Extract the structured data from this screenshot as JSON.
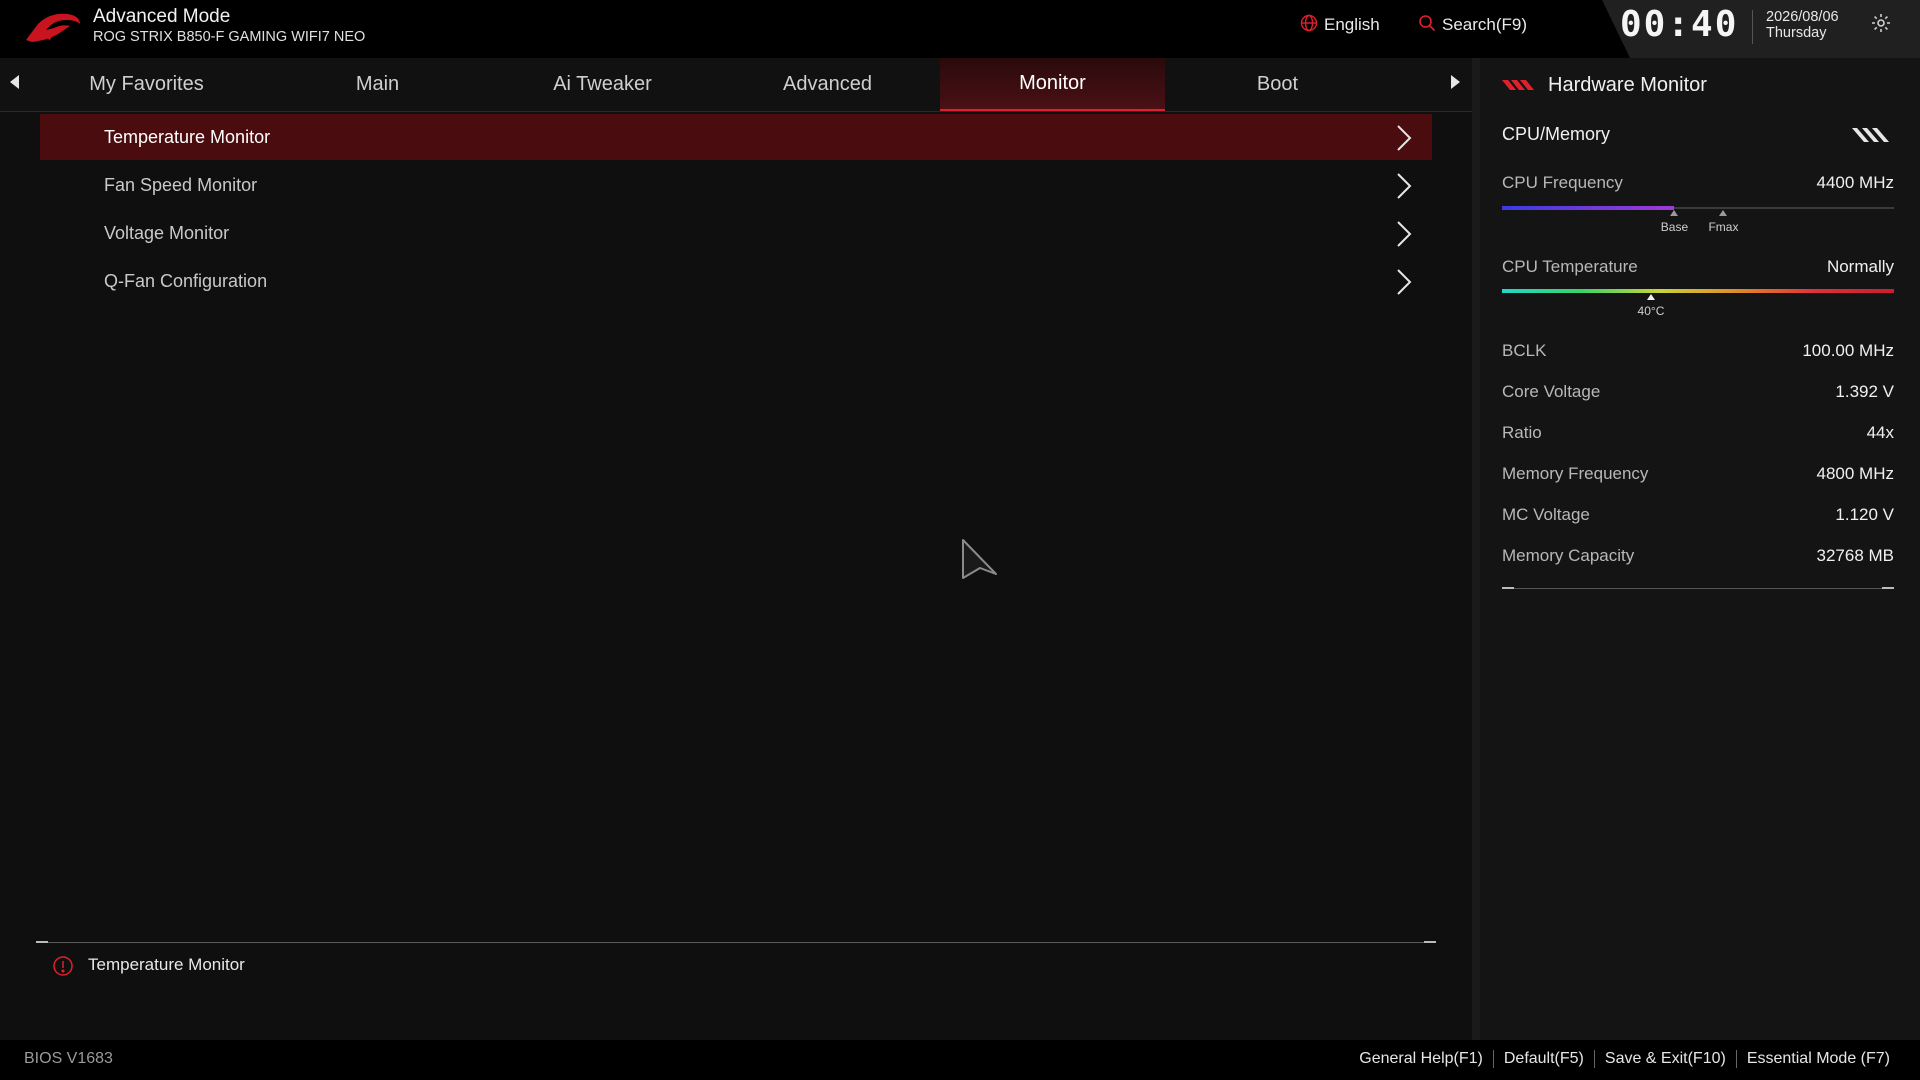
{
  "header": {
    "mode_title": "Advanced Mode",
    "board_name": "ROG STRIX B850-F GAMING WIFI7 NEO",
    "language": "English",
    "search": "Search(F9)",
    "time": "00:40",
    "date": "2026/08/06",
    "weekday": "Thursday"
  },
  "tabs": [
    {
      "label": "My Favorites"
    },
    {
      "label": "Main"
    },
    {
      "label": "Ai Tweaker"
    },
    {
      "label": "Advanced"
    },
    {
      "label": "Monitor",
      "active": true
    },
    {
      "label": "Boot"
    }
  ],
  "menu": [
    {
      "label": "Temperature Monitor",
      "selected": true
    },
    {
      "label": "Fan Speed Monitor"
    },
    {
      "label": "Voltage Monitor"
    },
    {
      "label": "Q-Fan Configuration"
    }
  ],
  "help": {
    "text": "Temperature Monitor"
  },
  "hardware_monitor": {
    "title": "Hardware Monitor",
    "section": "CPU/Memory",
    "cpu_frequency": {
      "label": "CPU Frequency",
      "value": "4400 MHz",
      "fill_fraction": 0.44,
      "base_label": "Base",
      "base_fraction": 0.44,
      "fmax_label": "Fmax",
      "fmax_fraction": 0.565
    },
    "cpu_temperature": {
      "label": "CPU Temperature",
      "value": "Normally",
      "marker_label": "40°C",
      "marker_fraction": 0.38
    },
    "rows": [
      {
        "label": "BCLK",
        "value": "100.00 MHz"
      },
      {
        "label": "Core Voltage",
        "value": "1.392 V"
      },
      {
        "label": "Ratio",
        "value": "44x"
      },
      {
        "label": "Memory Frequency",
        "value": "4800 MHz"
      },
      {
        "label": "MC Voltage",
        "value": "1.120 V"
      },
      {
        "label": "Memory Capacity",
        "value": "32768 MB"
      }
    ]
  },
  "footer": {
    "bios_version": "BIOS V1683",
    "actions": [
      "General Help(F1)",
      "Default(F5)",
      "Save & Exit(F10)",
      "Essential Mode (F7)"
    ]
  },
  "colors": {
    "accent_red": "#e0202c",
    "selected_row": "#4b0c10"
  }
}
